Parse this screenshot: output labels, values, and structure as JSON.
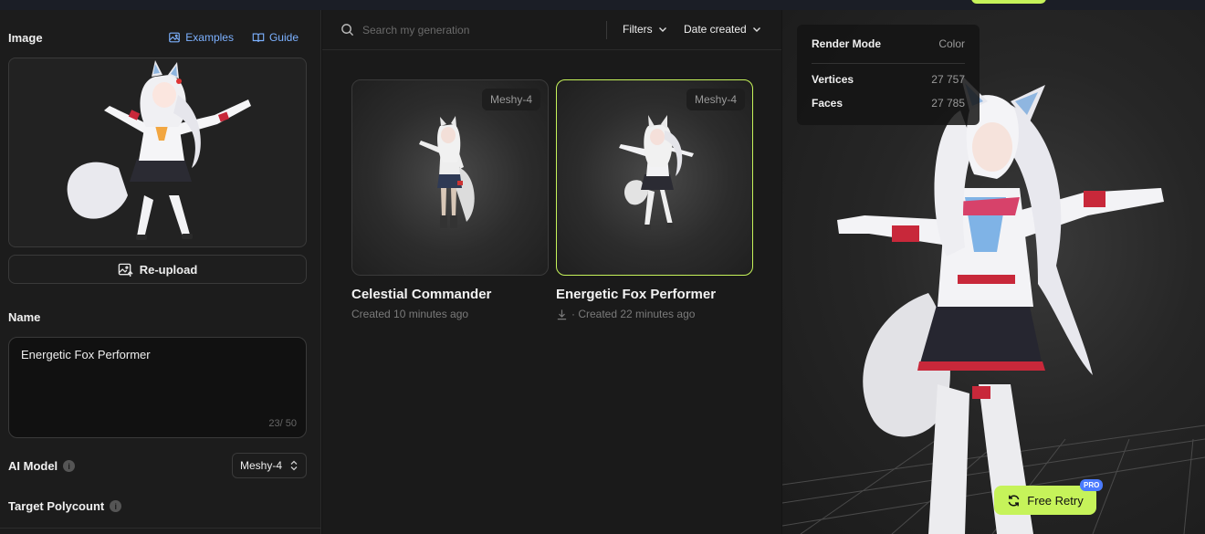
{
  "left": {
    "image_title": "Image",
    "examples_label": "Examples",
    "guide_label": "Guide",
    "reupload_label": "Re-upload",
    "name_title": "Name",
    "name_value": "Energetic Fox Performer",
    "name_count": "23/ 50",
    "ai_model_label": "AI Model",
    "ai_model_value": "Meshy-4",
    "target_polycount_label": "Target Polycount"
  },
  "middle": {
    "search_placeholder": "Search my generation",
    "filters_label": "Filters",
    "sort_label": "Date created",
    "cards": [
      {
        "badge": "Meshy-4",
        "title": "Celestial Commander",
        "meta": "Created 10 minutes ago"
      },
      {
        "badge": "Meshy-4",
        "title": "Energetic Fox Performer",
        "meta": "· Created 22 minutes ago"
      }
    ]
  },
  "viewer": {
    "render_mode_label": "Render Mode",
    "render_mode_value": "Color",
    "vertices_label": "Vertices",
    "vertices_value": "27 757",
    "faces_label": "Faces",
    "faces_value": "27 785",
    "retry_label": "Free Retry",
    "pro_badge": "PRO"
  },
  "colors": {
    "accent": "#c6f35a",
    "link": "#7cb1ff",
    "pro": "#4b7bff"
  }
}
